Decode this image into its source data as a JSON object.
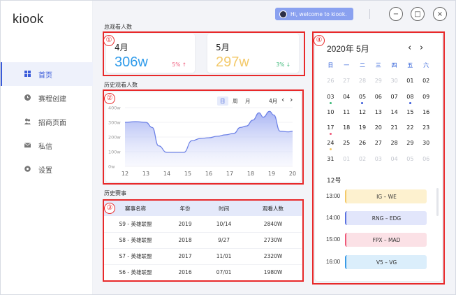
{
  "app": {
    "logo": "kiook"
  },
  "sidebar": {
    "items": [
      {
        "label": "首页",
        "icon": "grid-icon",
        "active": true
      },
      {
        "label": "赛程创建",
        "icon": "clock-icon",
        "active": false
      },
      {
        "label": "招商页面",
        "icon": "users-icon",
        "active": false
      },
      {
        "label": "私信",
        "icon": "mail-icon",
        "active": false
      },
      {
        "label": "设置",
        "icon": "gear-icon",
        "active": false
      }
    ]
  },
  "header": {
    "welcome": "Hi, welcome to kiook.",
    "buttons": [
      "−",
      "□",
      "×"
    ]
  },
  "annotations": [
    "①",
    "②",
    "③",
    "④"
  ],
  "viewers": {
    "title": "总观看人数",
    "cards": [
      {
        "month": "4月",
        "value": "306w",
        "change": "5% ↑",
        "value_color": "#2f9bea",
        "change_color": "#ef5a7a"
      },
      {
        "month": "5月",
        "value": "297w",
        "change": "3% ↓",
        "value_color": "#f3c969",
        "change_color": "#3cb878"
      }
    ]
  },
  "history": {
    "title": "历史观看人数",
    "tabs": [
      "日",
      "周",
      "月"
    ],
    "month": "4月",
    "prev": "‹",
    "next": "›"
  },
  "chart_data": {
    "type": "area",
    "x": [
      12,
      13,
      14,
      15,
      16,
      17,
      18,
      19,
      20
    ],
    "y_ticks": [
      "0w",
      "100w",
      "200w",
      "300w",
      "400w"
    ],
    "ylim": [
      0,
      400
    ],
    "series": [
      {
        "values": [
          [
            12,
            300
          ],
          [
            12.5,
            305
          ],
          [
            13,
            300
          ],
          [
            13.3,
            265
          ],
          [
            13.6,
            140
          ],
          [
            14,
            95
          ],
          [
            14.4,
            95
          ],
          [
            14.8,
            95
          ],
          [
            15.2,
            175
          ],
          [
            15.6,
            190
          ],
          [
            16,
            195
          ],
          [
            16.4,
            205
          ],
          [
            16.8,
            215
          ],
          [
            17.2,
            225
          ],
          [
            17.5,
            265
          ],
          [
            17.8,
            275
          ],
          [
            18.1,
            315
          ],
          [
            18.4,
            365
          ],
          [
            18.6,
            335
          ],
          [
            18.9,
            375
          ],
          [
            19.1,
            350
          ],
          [
            19.4,
            240
          ],
          [
            19.8,
            235
          ],
          [
            20,
            240
          ]
        ]
      }
    ],
    "grid": true
  },
  "matches": {
    "title": "历史赛事",
    "columns": [
      "赛事名称",
      "年份",
      "时间",
      "观看人数"
    ],
    "rows": [
      [
        "S9 - 英雄联盟",
        "2019",
        "10/14",
        "2840W"
      ],
      [
        "S8 - 英雄联盟",
        "2018",
        "9/27",
        "2730W"
      ],
      [
        "S7 - 英雄联盟",
        "2017",
        "11/01",
        "2320W"
      ],
      [
        "S6 - 英雄联盟",
        "2016",
        "07/01",
        "1980W"
      ]
    ]
  },
  "calendar": {
    "title": "2020年  5月",
    "prev": "‹",
    "next": "›",
    "weekdays": [
      "日",
      "一",
      "二",
      "三",
      "四",
      "五",
      "六"
    ],
    "weeks": [
      [
        [
          "26",
          "dim"
        ],
        [
          "27",
          "dim"
        ],
        [
          "28",
          "dim"
        ],
        [
          "29",
          "dim"
        ],
        [
          "30",
          "dim"
        ],
        [
          "01",
          "cur"
        ],
        [
          "02",
          "cur"
        ]
      ],
      [
        [
          "03",
          "cur",
          "#3cb878"
        ],
        [
          "04",
          "cur"
        ],
        [
          "05",
          "cur",
          "#3a5bd9"
        ],
        [
          "06",
          "cur"
        ],
        [
          "07",
          "cur"
        ],
        [
          "08",
          "cur",
          "#3a5bd9"
        ],
        [
          "09",
          "cur"
        ]
      ],
      [
        [
          "10",
          "cur"
        ],
        [
          "11",
          "cur"
        ],
        [
          "12",
          "cur"
        ],
        [
          "13",
          "cur"
        ],
        [
          "14",
          "cur"
        ],
        [
          "15",
          "cur"
        ],
        [
          "16",
          "cur"
        ]
      ],
      [
        [
          "17",
          "cur",
          "#ef5a7a"
        ],
        [
          "18",
          "cur"
        ],
        [
          "19",
          "cur"
        ],
        [
          "20",
          "cur"
        ],
        [
          "21",
          "cur"
        ],
        [
          "22",
          "cur"
        ],
        [
          "23",
          "cur"
        ]
      ],
      [
        [
          "24",
          "cur",
          "#f3c969"
        ],
        [
          "25",
          "cur"
        ],
        [
          "26",
          "cur"
        ],
        [
          "27",
          "cur"
        ],
        [
          "28",
          "cur"
        ],
        [
          "29",
          "cur"
        ],
        [
          "30",
          "cur"
        ]
      ],
      [
        [
          "31",
          "cur"
        ],
        [
          "01",
          "dim"
        ],
        [
          "02",
          "dim"
        ],
        [
          "03",
          "dim"
        ],
        [
          "04",
          "dim"
        ],
        [
          "05",
          "dim"
        ],
        [
          "06",
          "dim"
        ]
      ]
    ],
    "schedule_date": "12号",
    "schedule": [
      {
        "time": "13:00",
        "match": "IG – WE",
        "bg": "#fdf1cf",
        "bar": "#f3c969"
      },
      {
        "time": "14:00",
        "match": "RNG – EDG",
        "bg": "#e2e6fb",
        "bar": "#5c73e0"
      },
      {
        "time": "15:00",
        "match": "FPX – MAD",
        "bg": "#fbe1e6",
        "bar": "#ef5a7a"
      },
      {
        "time": "16:00",
        "match": "V5 – VG",
        "bg": "#dbeefb",
        "bar": "#3a9be6"
      }
    ]
  }
}
